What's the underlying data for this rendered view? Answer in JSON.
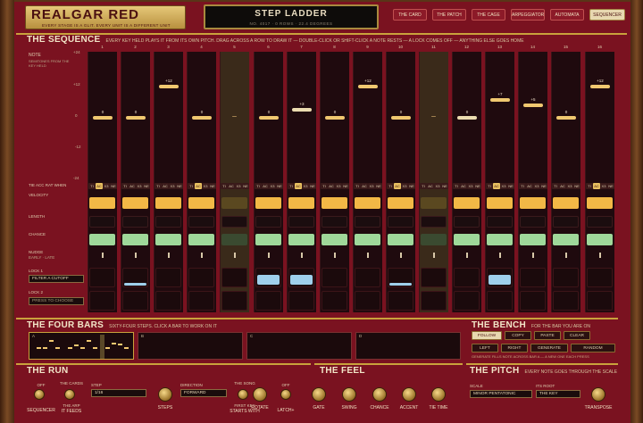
{
  "brand": {
    "title": "REALGAR RED",
    "subtitle": "EVERY STAGE IS A GLIT. EVERY UNIT IS A DIFFERENT UNIT"
  },
  "display": {
    "title": "STEP LADDER",
    "info": "NO. 4017 · 0 ROWS · 22.4 DEGREES"
  },
  "tabs": [
    "THE CARD",
    "THE PATCH",
    "THE CAGE",
    "ARPEGGIATOR",
    "AUTOMATA",
    "SEQUENCER"
  ],
  "active_tab": "SEQUENCER",
  "sequence": {
    "title": "THE SEQUENCE",
    "subtitle": "EVERY KEY HELD PLAYS IT FROM ITS OWN PITCH. DRAG ACROSS A ROW TO DRAW IT — DOUBLE-CLICK OR SHIFT-CLICK A NOTE RESTS — A LOCK COMES OFF — ANYTHING ELSE GOES HOME",
    "note_label": "NOTE",
    "note_sub": "SEMITONES FROM THE KEY HELD",
    "scale_ticks": [
      "+24",
      "+12",
      "0",
      "-12",
      "-24"
    ],
    "steps": [
      "1",
      "2",
      "3",
      "4",
      "5",
      "6",
      "7",
      "8",
      "9",
      "10",
      "11",
      "12",
      "13",
      "14",
      "15",
      "16"
    ],
    "pitches": [
      0,
      0,
      12,
      0,
      null,
      0,
      3,
      0,
      12,
      0,
      null,
      0,
      7,
      5,
      0,
      12
    ],
    "pitch_labels": [
      "0",
      "0",
      "+12",
      "0",
      "",
      "0",
      "+3",
      "0",
      "+12",
      "0",
      "",
      "0",
      "+7",
      "+5",
      "0",
      "+12"
    ],
    "rows": {
      "tie": "TIE ACC RAT WHEN",
      "velocity": "VELOCITY",
      "length": "LENGTH",
      "chance": "CHANCE",
      "nudge": "NUDGE",
      "nudge_sub": "EARLY · LATE",
      "lock1": "LOCK 1",
      "lock1_target": "FILTER A CUTOFF",
      "lock2": "LOCK 2",
      "lock2_target": "PRESS TO CHOOSE"
    },
    "chips": [
      "TI",
      "AC",
      "X3",
      "NE"
    ]
  },
  "bars": {
    "title": "THE FOUR BARS",
    "subtitle": "SIXTY-FOUR STEPS. CLICK A BAR TO WORK ON IT",
    "labels": [
      "A",
      "B",
      "C",
      "D"
    ]
  },
  "bench": {
    "title": "THE BENCH",
    "subtitle": "FOR THE BAR YOU ARE ON",
    "buttons": [
      "FOLLOW",
      "COPY",
      "PASTE",
      "CLEAR",
      "LEFT",
      "RIGHT",
      "GENERATE",
      "RANDOM"
    ],
    "note": "GENERATE FILLS NOTE ACROSS BAR A — A NEW ONE EACH PRESS"
  },
  "run": {
    "title": "THE RUN",
    "seq_state": "OFF",
    "seq_label": "SEQUENCER",
    "cards_label": "THE CARDS",
    "arp_label": "THE ARP",
    "feeds_label": "IT FEEDS",
    "step_label": "STEP",
    "step_value": "1/16",
    "steps_label": "STEPS",
    "direction_label": "DIRECTION",
    "direction_value": "FORWARD",
    "song_label": "THE SONG",
    "first_key": "FIRST KEY",
    "starts_label": "STARTS WITH",
    "rotate_label": "ROTATE",
    "latch_state": "OFF",
    "latch_label": "LATCH+"
  },
  "feel": {
    "title": "THE FEEL",
    "knobs": [
      "GATE",
      "SWING",
      "CHANCE",
      "ACCENT",
      "TIE TIME"
    ]
  },
  "pitch": {
    "title": "THE PITCH",
    "subtitle": "EVERY NOTE GOES THROUGH THE SCALE",
    "scale_label": "SCALE",
    "scale_value": "MINOR PENTATONIC",
    "root_label": "ITS ROOT",
    "root_value": "THE KEY",
    "transpose_label": "TRANSPOSE"
  }
}
